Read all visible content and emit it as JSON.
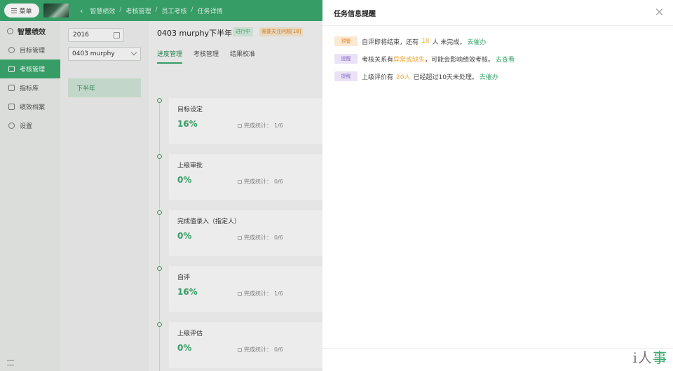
{
  "topbar": {
    "menu_label": "菜单",
    "breadcrumbs": [
      "智慧绩效",
      "考核管理",
      "员工考核",
      "任务详情"
    ],
    "separator": "/"
  },
  "sidebar": {
    "brand": "智慧绩效",
    "items": [
      {
        "label": "目标管理",
        "icon": "target-icon"
      },
      {
        "label": "考核管理",
        "icon": "assessment-icon",
        "active": true
      },
      {
        "label": "指标库",
        "icon": "library-icon"
      },
      {
        "label": "绩效档案",
        "icon": "archive-icon"
      },
      {
        "label": "设置",
        "icon": "gear-icon"
      }
    ]
  },
  "filters": {
    "year": "2016",
    "plan": "0403 murphy",
    "period": "下半年"
  },
  "main": {
    "title": "0403 murphy下半年",
    "status": "进行中",
    "warning": "需要关注问题[18]",
    "tabs": [
      "进度管理",
      "考核管理",
      "结果校准"
    ],
    "stat_label": "完成统计：",
    "steps": [
      {
        "name": "目标设定",
        "percent": "16%",
        "count": "1/6"
      },
      {
        "name": "上级审批",
        "percent": "0%",
        "count": "0/6"
      },
      {
        "name": "完成值录入（指定人）",
        "percent": "0%",
        "count": "0/6"
      },
      {
        "name": "自评",
        "percent": "16%",
        "count": "1/6"
      },
      {
        "name": "上级评估",
        "percent": "0%",
        "count": "0/6"
      }
    ]
  },
  "drawer": {
    "title": "任务信息提醒",
    "notices": [
      {
        "badge": "预警",
        "pre": "自评即将结束，还有",
        "highlight": "18",
        "post": "人 未完成。",
        "link": "去催办"
      },
      {
        "badge": "提醒",
        "pre": "考核关系有",
        "highlight": "异常或缺失",
        "post": "，可能会影响绩效考核。",
        "link": "去查看"
      },
      {
        "badge": "提醒",
        "pre": "上级评价有",
        "highlight": "20人",
        "post": "已经超过10天未处理。",
        "link": "去催办"
      }
    ]
  },
  "watermark": {
    "part1": "i人",
    "part2": "事"
  },
  "colors": {
    "primary": "#3aa76d",
    "warning": "#f2a93b",
    "info_badge": "#8a6cc7"
  }
}
